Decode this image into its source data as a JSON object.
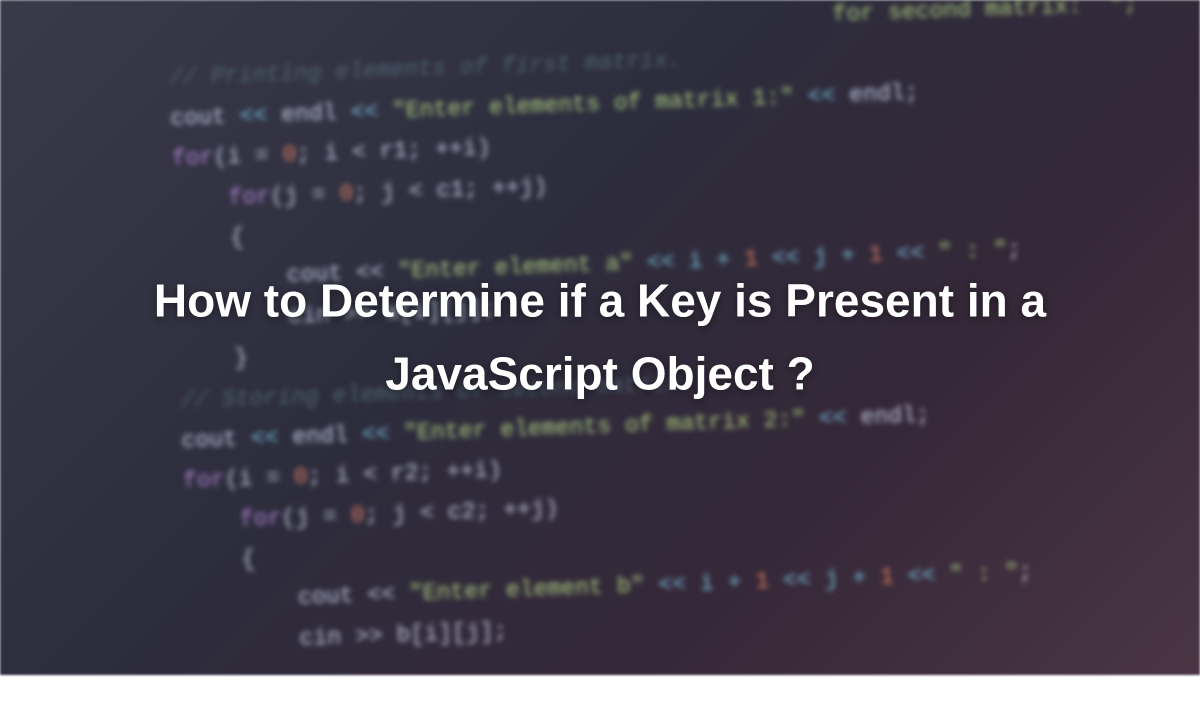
{
  "title": "How to Determine if a Key is Present in a JavaScript Object ?",
  "code": {
    "line1_comment": "for second matrix:  \";",
    "line2": "// Printing elements of first matrix.",
    "line3_a": "cout",
    "line3_b": " << ",
    "line3_c": "endl",
    "line3_d": " << ",
    "line3_e": "\"Enter elements of matrix 1:\"",
    "line3_f": " << ",
    "line3_g": "endl;",
    "line4_a": "for",
    "line4_b": "(i = ",
    "line4_c": "0",
    "line4_d": "; i < r1; ++i)",
    "line5_a": "for",
    "line5_b": "(j = ",
    "line5_c": "0",
    "line5_d": "; j < c1; ++j)",
    "line6": "{",
    "line7_a": "cout << ",
    "line7_b": "\"Enter element a\"",
    "line7_c": " << i + ",
    "line7_d": "1",
    "line7_e": " << j + ",
    "line7_f": "1",
    "line7_g": " << ",
    "line7_h": "\" : \"",
    "line7_i": ";",
    "line8": "cin >> a[i][j];",
    "line9": "}",
    "line10": "// Storing elements of second matrix.",
    "line11_a": "cout",
    "line11_b": " << ",
    "line11_c": "endl",
    "line11_d": " << ",
    "line11_e": "\"Enter elements of matrix 2:\"",
    "line11_f": " << ",
    "line11_g": "endl;",
    "line12_a": "for",
    "line12_b": "(i = ",
    "line12_c": "0",
    "line12_d": "; i < r2; ++i)",
    "line13_a": "for",
    "line13_b": "(j = ",
    "line13_c": "0",
    "line13_d": "; j < c2; ++j)",
    "line14": "{",
    "line15_a": "cout << ",
    "line15_b": "\"Enter element b\"",
    "line15_c": " << i + ",
    "line15_d": "1",
    "line15_e": " << j + ",
    "line15_f": "1",
    "line15_g": " << ",
    "line15_h": "\" : \"",
    "line15_i": ";",
    "line16": "cin >> b[i][j];"
  }
}
